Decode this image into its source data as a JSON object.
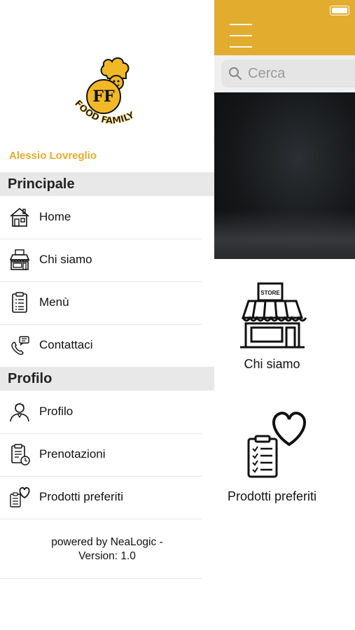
{
  "drawer": {
    "brand": {
      "logo_text": "FOOD FAMILY",
      "monogram": "FF"
    },
    "username": "Alessio Lovreglio",
    "sections": [
      {
        "title": "Principale"
      },
      {
        "title": "Profilo"
      }
    ],
    "main_items": [
      {
        "label": "Home",
        "icon": "house-icon"
      },
      {
        "label": "Chi siamo",
        "icon": "store-icon"
      },
      {
        "label": "Menù",
        "icon": "clipboard-icon"
      },
      {
        "label": "Contattaci",
        "icon": "phone-chat-icon"
      }
    ],
    "profile_items": [
      {
        "label": "Profilo",
        "icon": "user-icon"
      },
      {
        "label": "Prenotazioni",
        "icon": "clipboard-clock-icon"
      },
      {
        "label": "Prodotti preferiti",
        "icon": "clipboard-heart-icon"
      }
    ],
    "footer": {
      "line1": "powered by NeaLogic -",
      "line2": "Version: 1.0"
    }
  },
  "main": {
    "search": {
      "placeholder": "Cerca"
    },
    "tiles": [
      {
        "label": "Chi siamo",
        "icon": "store-icon",
        "sign": "STORE"
      },
      {
        "label": "Prodotti preferiti",
        "icon": "clipboard-heart-icon"
      }
    ]
  },
  "colors": {
    "accent": "#E2AC2E",
    "section_bg": "#e8e8e8"
  }
}
